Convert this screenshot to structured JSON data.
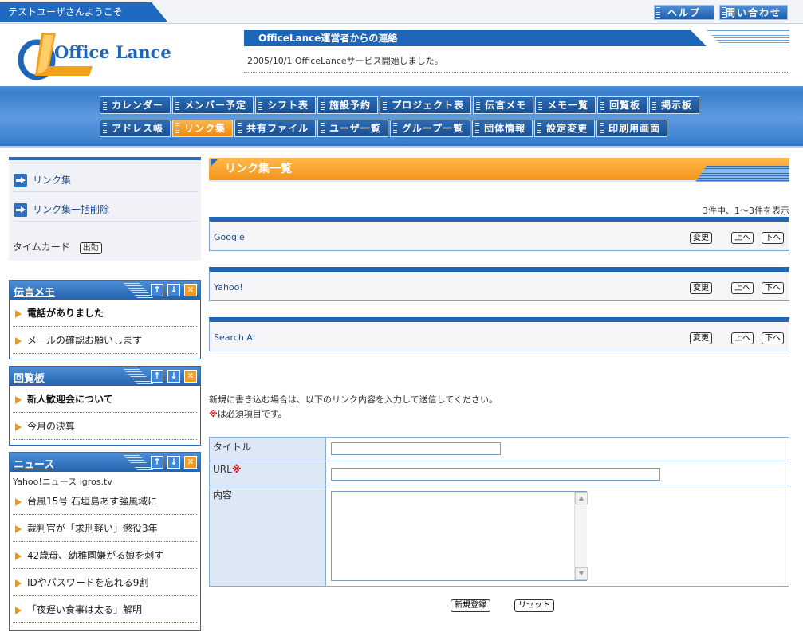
{
  "topbar": {
    "welcome": "テストユーザさんようこそ",
    "help_label": "ヘルプ",
    "contact_label": "問い合わせ"
  },
  "header": {
    "logo_text": "Office Lance",
    "notice_title": "OfficeLance運営者からの連絡",
    "notice_text": "2005/10/1 OfficeLanceサービス開始しました。"
  },
  "nav": {
    "row1": [
      "カレンダー",
      "メンバー予定",
      "シフト表",
      "施設予約",
      "プロジェクト表",
      "伝言メモ",
      "メモ一覧",
      "回覧板",
      "掲示板"
    ],
    "row2": [
      "アドレス帳",
      "リンク集",
      "共有ファイル",
      "ユーザ一覧",
      "グループ一覧",
      "団体情報",
      "設定変更",
      "印刷用画面"
    ],
    "active": "リンク集"
  },
  "sidebar": {
    "links": [
      "リンク集",
      "リンク集一括削除"
    ],
    "timecard_label": "タイムカード",
    "timecard_button": "出勤",
    "panels": {
      "memo": {
        "title": "伝言メモ",
        "items": [
          {
            "text": "電話がありました",
            "bold": true
          },
          {
            "text": "メールの確認お願いします",
            "bold": false
          }
        ]
      },
      "circular": {
        "title": "回覧板",
        "items": [
          {
            "text": "新人歓迎会について",
            "bold": true
          },
          {
            "text": "今月の決算",
            "bold": false
          }
        ]
      },
      "news": {
        "title": "ニュース",
        "source": "Yahoo!ニュース igros.tv",
        "items": [
          {
            "text": "台風15号 石垣島あす強風域に",
            "bold": false
          },
          {
            "text": "裁判官が「求刑軽い」懲役3年",
            "bold": false
          },
          {
            "text": "42歳母、幼稚園嫌がる娘を刺す",
            "bold": false
          },
          {
            "text": "IDやパスワードを忘れる9割",
            "bold": false
          },
          {
            "text": "「夜遅い食事は太る」解明",
            "bold": false
          }
        ]
      }
    }
  },
  "main": {
    "title": "リンク集一覧",
    "count_text": "3件中、1〜3件を表示",
    "links": [
      {
        "name": "Google"
      },
      {
        "name": "Yahoo!"
      },
      {
        "name": "Search AI"
      }
    ],
    "edit_label": "変更",
    "up_label": "上へ",
    "down_label": "下へ",
    "instruction": "新規に書き込む場合は、以下のリンク内容を入力して送信してください。",
    "required_mark": "※",
    "required_note": "は必須項目です。",
    "form": {
      "title_label": "タイトル",
      "url_label": "URL",
      "content_label": "内容",
      "title_value": "",
      "url_value": "",
      "content_value": ""
    },
    "register_label": "新規登録",
    "reset_label": "リセット"
  },
  "colors": {
    "primary_blue": "#1e66b8",
    "accent_orange": "#f39419",
    "required_red": "#d41414"
  }
}
